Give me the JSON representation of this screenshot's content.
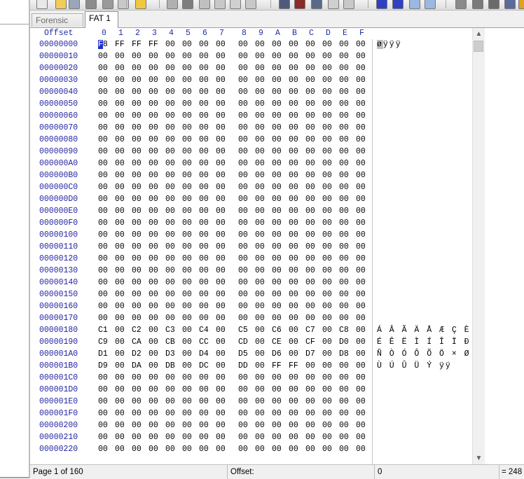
{
  "tabs": [
    {
      "label": "Forensic girl",
      "active": false
    },
    {
      "label": "FAT 1",
      "active": true
    }
  ],
  "toolbar_icons": [
    "new-file-icon",
    "open-folder-icon",
    "save-icon",
    "print-icon",
    "print-preview-icon",
    "properties-icon",
    "open-folder-icon",
    "undo-icon",
    "copy-icon",
    "paste-icon",
    "paste-write-icon",
    "paste-zero-icon",
    "clipboard-hex-icon",
    "search-icon",
    "search-replace-icon",
    "search-hex-icon",
    "search-text-icon",
    "search-next-icon",
    "goto-offset-icon",
    "jump-icon",
    "back-icon",
    "forward-icon",
    "disk-icon",
    "ram-icon",
    "memory-icon",
    "calculator-icon",
    "settings-icon"
  ],
  "columns": {
    "offset_label": "Offset",
    "byte_labels": [
      "0",
      "1",
      "2",
      "3",
      "4",
      "5",
      "6",
      "7",
      "8",
      "9",
      "A",
      "B",
      "C",
      "D",
      "E",
      "F"
    ]
  },
  "rows": [
    {
      "offset": "00000000",
      "bytes": [
        "F8",
        "FF",
        "FF",
        "FF",
        "00",
        "00",
        "00",
        "00",
        "00",
        "00",
        "00",
        "00",
        "00",
        "00",
        "00",
        "00"
      ],
      "text": "øÿÿÿ"
    },
    {
      "offset": "00000010",
      "bytes": [
        "00",
        "00",
        "00",
        "00",
        "00",
        "00",
        "00",
        "00",
        "00",
        "00",
        "00",
        "00",
        "00",
        "00",
        "00",
        "00"
      ],
      "text": ""
    },
    {
      "offset": "00000020",
      "bytes": [
        "00",
        "00",
        "00",
        "00",
        "00",
        "00",
        "00",
        "00",
        "00",
        "00",
        "00",
        "00",
        "00",
        "00",
        "00",
        "00"
      ],
      "text": ""
    },
    {
      "offset": "00000030",
      "bytes": [
        "00",
        "00",
        "00",
        "00",
        "00",
        "00",
        "00",
        "00",
        "00",
        "00",
        "00",
        "00",
        "00",
        "00",
        "00",
        "00"
      ],
      "text": ""
    },
    {
      "offset": "00000040",
      "bytes": [
        "00",
        "00",
        "00",
        "00",
        "00",
        "00",
        "00",
        "00",
        "00",
        "00",
        "00",
        "00",
        "00",
        "00",
        "00",
        "00"
      ],
      "text": ""
    },
    {
      "offset": "00000050",
      "bytes": [
        "00",
        "00",
        "00",
        "00",
        "00",
        "00",
        "00",
        "00",
        "00",
        "00",
        "00",
        "00",
        "00",
        "00",
        "00",
        "00"
      ],
      "text": ""
    },
    {
      "offset": "00000060",
      "bytes": [
        "00",
        "00",
        "00",
        "00",
        "00",
        "00",
        "00",
        "00",
        "00",
        "00",
        "00",
        "00",
        "00",
        "00",
        "00",
        "00"
      ],
      "text": ""
    },
    {
      "offset": "00000070",
      "bytes": [
        "00",
        "00",
        "00",
        "00",
        "00",
        "00",
        "00",
        "00",
        "00",
        "00",
        "00",
        "00",
        "00",
        "00",
        "00",
        "00"
      ],
      "text": ""
    },
    {
      "offset": "00000080",
      "bytes": [
        "00",
        "00",
        "00",
        "00",
        "00",
        "00",
        "00",
        "00",
        "00",
        "00",
        "00",
        "00",
        "00",
        "00",
        "00",
        "00"
      ],
      "text": ""
    },
    {
      "offset": "00000090",
      "bytes": [
        "00",
        "00",
        "00",
        "00",
        "00",
        "00",
        "00",
        "00",
        "00",
        "00",
        "00",
        "00",
        "00",
        "00",
        "00",
        "00"
      ],
      "text": ""
    },
    {
      "offset": "000000A0",
      "bytes": [
        "00",
        "00",
        "00",
        "00",
        "00",
        "00",
        "00",
        "00",
        "00",
        "00",
        "00",
        "00",
        "00",
        "00",
        "00",
        "00"
      ],
      "text": ""
    },
    {
      "offset": "000000B0",
      "bytes": [
        "00",
        "00",
        "00",
        "00",
        "00",
        "00",
        "00",
        "00",
        "00",
        "00",
        "00",
        "00",
        "00",
        "00",
        "00",
        "00"
      ],
      "text": ""
    },
    {
      "offset": "000000C0",
      "bytes": [
        "00",
        "00",
        "00",
        "00",
        "00",
        "00",
        "00",
        "00",
        "00",
        "00",
        "00",
        "00",
        "00",
        "00",
        "00",
        "00"
      ],
      "text": ""
    },
    {
      "offset": "000000D0",
      "bytes": [
        "00",
        "00",
        "00",
        "00",
        "00",
        "00",
        "00",
        "00",
        "00",
        "00",
        "00",
        "00",
        "00",
        "00",
        "00",
        "00"
      ],
      "text": ""
    },
    {
      "offset": "000000E0",
      "bytes": [
        "00",
        "00",
        "00",
        "00",
        "00",
        "00",
        "00",
        "00",
        "00",
        "00",
        "00",
        "00",
        "00",
        "00",
        "00",
        "00"
      ],
      "text": ""
    },
    {
      "offset": "000000F0",
      "bytes": [
        "00",
        "00",
        "00",
        "00",
        "00",
        "00",
        "00",
        "00",
        "00",
        "00",
        "00",
        "00",
        "00",
        "00",
        "00",
        "00"
      ],
      "text": ""
    },
    {
      "offset": "00000100",
      "bytes": [
        "00",
        "00",
        "00",
        "00",
        "00",
        "00",
        "00",
        "00",
        "00",
        "00",
        "00",
        "00",
        "00",
        "00",
        "00",
        "00"
      ],
      "text": ""
    },
    {
      "offset": "00000110",
      "bytes": [
        "00",
        "00",
        "00",
        "00",
        "00",
        "00",
        "00",
        "00",
        "00",
        "00",
        "00",
        "00",
        "00",
        "00",
        "00",
        "00"
      ],
      "text": ""
    },
    {
      "offset": "00000120",
      "bytes": [
        "00",
        "00",
        "00",
        "00",
        "00",
        "00",
        "00",
        "00",
        "00",
        "00",
        "00",
        "00",
        "00",
        "00",
        "00",
        "00"
      ],
      "text": ""
    },
    {
      "offset": "00000130",
      "bytes": [
        "00",
        "00",
        "00",
        "00",
        "00",
        "00",
        "00",
        "00",
        "00",
        "00",
        "00",
        "00",
        "00",
        "00",
        "00",
        "00"
      ],
      "text": ""
    },
    {
      "offset": "00000140",
      "bytes": [
        "00",
        "00",
        "00",
        "00",
        "00",
        "00",
        "00",
        "00",
        "00",
        "00",
        "00",
        "00",
        "00",
        "00",
        "00",
        "00"
      ],
      "text": ""
    },
    {
      "offset": "00000150",
      "bytes": [
        "00",
        "00",
        "00",
        "00",
        "00",
        "00",
        "00",
        "00",
        "00",
        "00",
        "00",
        "00",
        "00",
        "00",
        "00",
        "00"
      ],
      "text": ""
    },
    {
      "offset": "00000160",
      "bytes": [
        "00",
        "00",
        "00",
        "00",
        "00",
        "00",
        "00",
        "00",
        "00",
        "00",
        "00",
        "00",
        "00",
        "00",
        "00",
        "00"
      ],
      "text": ""
    },
    {
      "offset": "00000170",
      "bytes": [
        "00",
        "00",
        "00",
        "00",
        "00",
        "00",
        "00",
        "00",
        "00",
        "00",
        "00",
        "00",
        "00",
        "00",
        "00",
        "00"
      ],
      "text": ""
    },
    {
      "offset": "00000180",
      "bytes": [
        "C1",
        "00",
        "C2",
        "00",
        "C3",
        "00",
        "C4",
        "00",
        "C5",
        "00",
        "C6",
        "00",
        "C7",
        "00",
        "C8",
        "00"
      ],
      "text": "Á Â Ã Ä Å Æ Ç È"
    },
    {
      "offset": "00000190",
      "bytes": [
        "C9",
        "00",
        "CA",
        "00",
        "CB",
        "00",
        "CC",
        "00",
        "CD",
        "00",
        "CE",
        "00",
        "CF",
        "00",
        "D0",
        "00"
      ],
      "text": "É Ê Ë Ì Í Î Ï Ð"
    },
    {
      "offset": "000001A0",
      "bytes": [
        "D1",
        "00",
        "D2",
        "00",
        "D3",
        "00",
        "D4",
        "00",
        "D5",
        "00",
        "D6",
        "00",
        "D7",
        "00",
        "D8",
        "00"
      ],
      "text": "Ñ Ò Ó Ô Õ Ö × Ø"
    },
    {
      "offset": "000001B0",
      "bytes": [
        "D9",
        "00",
        "DA",
        "00",
        "DB",
        "00",
        "DC",
        "00",
        "DD",
        "00",
        "FF",
        "FF",
        "00",
        "00",
        "00",
        "00"
      ],
      "text": "Ù Ú Û Ü Ý ÿÿ"
    },
    {
      "offset": "000001C0",
      "bytes": [
        "00",
        "00",
        "00",
        "00",
        "00",
        "00",
        "00",
        "00",
        "00",
        "00",
        "00",
        "00",
        "00",
        "00",
        "00",
        "00"
      ],
      "text": ""
    },
    {
      "offset": "000001D0",
      "bytes": [
        "00",
        "00",
        "00",
        "00",
        "00",
        "00",
        "00",
        "00",
        "00",
        "00",
        "00",
        "00",
        "00",
        "00",
        "00",
        "00"
      ],
      "text": ""
    },
    {
      "offset": "000001E0",
      "bytes": [
        "00",
        "00",
        "00",
        "00",
        "00",
        "00",
        "00",
        "00",
        "00",
        "00",
        "00",
        "00",
        "00",
        "00",
        "00",
        "00"
      ],
      "text": ""
    },
    {
      "offset": "000001F0",
      "bytes": [
        "00",
        "00",
        "00",
        "00",
        "00",
        "00",
        "00",
        "00",
        "00",
        "00",
        "00",
        "00",
        "00",
        "00",
        "00",
        "00"
      ],
      "text": ""
    },
    {
      "offset": "00000200",
      "bytes": [
        "00",
        "00",
        "00",
        "00",
        "00",
        "00",
        "00",
        "00",
        "00",
        "00",
        "00",
        "00",
        "00",
        "00",
        "00",
        "00"
      ],
      "text": ""
    },
    {
      "offset": "00000210",
      "bytes": [
        "00",
        "00",
        "00",
        "00",
        "00",
        "00",
        "00",
        "00",
        "00",
        "00",
        "00",
        "00",
        "00",
        "00",
        "00",
        "00"
      ],
      "text": ""
    },
    {
      "offset": "00000220",
      "bytes": [
        "00",
        "00",
        "00",
        "00",
        "00",
        "00",
        "00",
        "00",
        "00",
        "00",
        "00",
        "00",
        "00",
        "00",
        "00",
        "00"
      ],
      "text": ""
    }
  ],
  "cursor": {
    "row": 0,
    "col": 0
  },
  "status": {
    "page": "Page 1 of 160",
    "offset_label": "Offset:",
    "offset_value": "0",
    "selection_value": "= 248"
  },
  "colors": {
    "offset_text": "#2323a5",
    "header_text": "#1c2fa8",
    "cursor": "#1e2fcf"
  }
}
